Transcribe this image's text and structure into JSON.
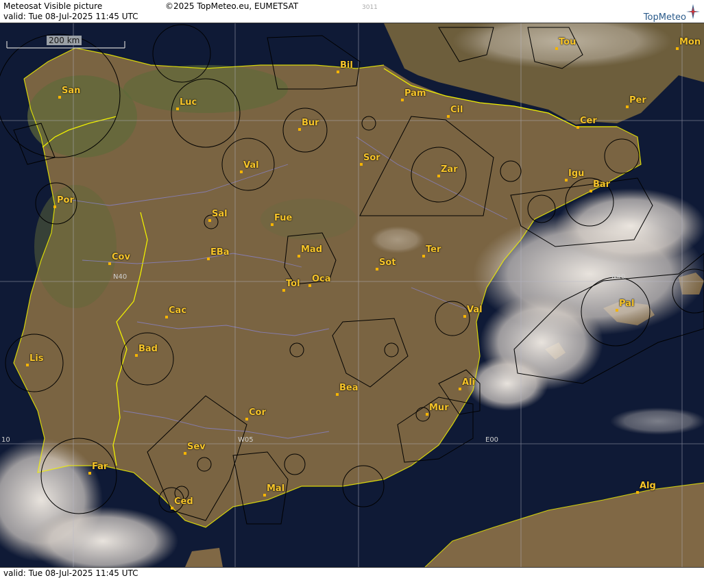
{
  "header": {
    "title": "Meteosat Visible picture",
    "valid": "valid:  Tue  08-Jul-2025  11:45 UTC",
    "copyright": "©2025 TopMeteo.eu, EUMETSAT",
    "code": "3011",
    "logo_text": "TopMeteo"
  },
  "footer": {
    "valid": "valid:  Tue  08-Jul-2025  11:45 UTC"
  },
  "scale": {
    "label": "200 km"
  },
  "grid_labels": {
    "n40_west": "N40",
    "n40_east": "N40",
    "w05": "W05",
    "e00": "E00",
    "w10": "10"
  },
  "cities": [
    {
      "name": "San"
    },
    {
      "name": "Luc"
    },
    {
      "name": "Bil"
    },
    {
      "name": "Pam"
    },
    {
      "name": "Tou"
    },
    {
      "name": "Mon"
    },
    {
      "name": "Per"
    },
    {
      "name": "Cil"
    },
    {
      "name": "Bur"
    },
    {
      "name": "Cer"
    },
    {
      "name": "Val"
    },
    {
      "name": "Sor"
    },
    {
      "name": "Zar"
    },
    {
      "name": "Igu"
    },
    {
      "name": "Bar"
    },
    {
      "name": "Por"
    },
    {
      "name": "Sal"
    },
    {
      "name": "Fue"
    },
    {
      "name": "Mad"
    },
    {
      "name": "Cov"
    },
    {
      "name": "EBa"
    },
    {
      "name": "Ter"
    },
    {
      "name": "Sot"
    },
    {
      "name": "Oca"
    },
    {
      "name": "Tol"
    },
    {
      "name": "Pal"
    },
    {
      "name": "Cac"
    },
    {
      "name": "Val"
    },
    {
      "name": "Bad"
    },
    {
      "name": "Lis"
    },
    {
      "name": "Ali"
    },
    {
      "name": "Bea"
    },
    {
      "name": "Mur"
    },
    {
      "name": "Cor"
    },
    {
      "name": "Sev"
    },
    {
      "name": "Far"
    },
    {
      "name": "Mal"
    },
    {
      "name": "Ced"
    },
    {
      "name": "Alg"
    }
  ]
}
